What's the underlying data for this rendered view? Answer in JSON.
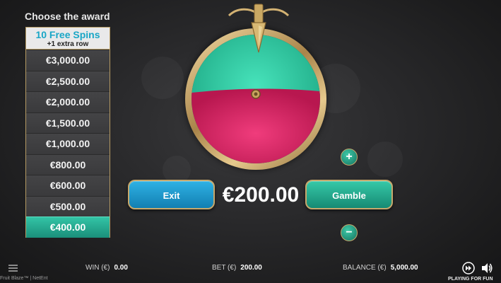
{
  "award": {
    "title": "Choose the award",
    "spins": "10 Free Spins",
    "extra": "+1 extra row",
    "values": [
      "€3,000.00",
      "€2,500.00",
      "€2,000.00",
      "€1,500.00",
      "€1,000.00",
      "€800.00",
      "€600.00",
      "€500.00",
      "€400.00"
    ],
    "active_value": "€400.00"
  },
  "wheel": {
    "top_color": "#2fd3a9",
    "bottom_color": "#e22a6b"
  },
  "controls": {
    "exit_label": "Exit",
    "gamble_label": "Gamble",
    "amount": "€200.00",
    "plus_label": "+",
    "minus_label": "−"
  },
  "footer": {
    "win_label": "WIN (€)",
    "win_value": "0.00",
    "bet_label": "BET (€)",
    "bet_value": "200.00",
    "balance_label": "BALANCE (€)",
    "balance_value": "5,000.00",
    "brand": "Fruit Blaze™ | NetEnt",
    "mode": "PLAYING FOR FUN"
  }
}
